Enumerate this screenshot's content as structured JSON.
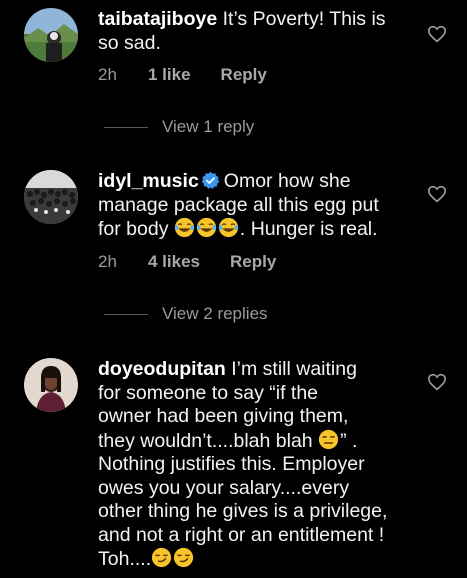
{
  "comments": [
    {
      "username": "taibatajiboye",
      "text_line1": " It’s Poverty! This is",
      "text_line2": "so sad.",
      "time": "2h",
      "likes": "1 like",
      "reply": "Reply",
      "view_replies": "View 1 reply",
      "verified": false
    },
    {
      "username": "idyl_music",
      "text_line1": "Omor how she",
      "text_line2": "manage package all this egg put",
      "text_line3_pre": "for body ",
      "text_line3_post": ". Hunger is real.",
      "time": "2h",
      "likes": "4 likes",
      "reply": "Reply",
      "view_replies": "View 2 replies",
      "verified": true
    },
    {
      "username": "doyeodupitan",
      "text_line1": " I’m still waiting",
      "text_line2": "for someone to say “if the",
      "text_line3": "owner had been giving them,",
      "text_line4_pre": "they wouldn’t....blah blah ",
      "text_line4_post": "” .",
      "text_line5": "Nothing justifies this. Employer",
      "text_line6": "owes you your salary....every",
      "text_line7": "other thing he gives is a privilege,",
      "text_line8": "and not a right or an entitlement !",
      "text_line9_pre": "Toh....",
      "verified": false
    }
  ],
  "colors": {
    "background": "#000000",
    "text": "#f2f2f2",
    "muted": "#9a9a9a",
    "verified_blue": "#3897f0",
    "emoji_yellow": "#f7c52b"
  },
  "icons": {
    "heart": "heart-outline-icon",
    "verified": "verified-badge-icon",
    "laugh": "face-with-tears-of-joy-emoji",
    "expressionless": "expressionless-face-emoji",
    "smirk": "smirking-face-emoji"
  }
}
